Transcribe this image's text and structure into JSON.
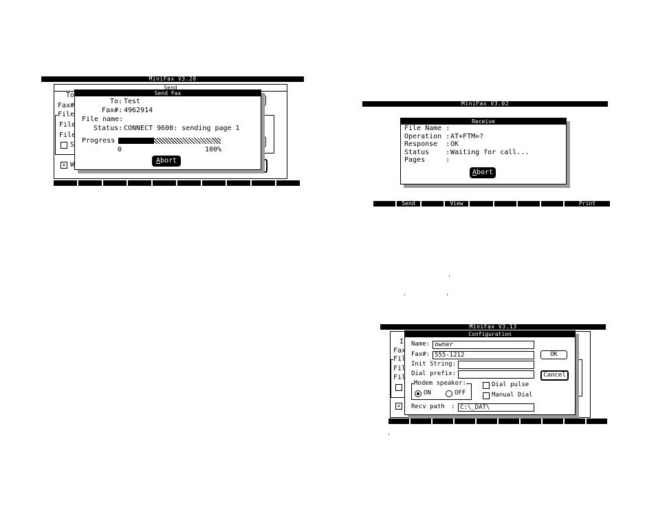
{
  "send_screen": {
    "app_title": "MiniFax  V3.20",
    "bg_panel_title": "Send",
    "bg_labels": [
      "To",
      "Fax#",
      "File",
      "File",
      "File"
    ],
    "bg_checkbox_label": "S",
    "bg_checkbox2_label": "W",
    "dialog": {
      "title": "Send Fax",
      "to_label": "To:",
      "to_value": "Test",
      "fax_label": "Fax#:",
      "fax_value": "4962914",
      "file_label": "File name:",
      "file_value": "",
      "status_label": "Status:",
      "status_value": "CONNECT 9600: sending page 1",
      "progress_label": "Progress",
      "progress_min": "0",
      "progress_max": "100%",
      "progress_fraction": 0.35,
      "abort_label": "Abort"
    },
    "function_keys": [
      "",
      "",
      "",
      "",
      "",
      "",
      "",
      "",
      "",
      ""
    ]
  },
  "receive_screen": {
    "app_title": "MiniFax  V3.02",
    "dialog": {
      "title": "Receive",
      "rows": [
        {
          "label": "File Name",
          "value": ""
        },
        {
          "label": "Operation",
          "value": "AT+FTM=?"
        },
        {
          "label": "Response ",
          "value": "OK"
        },
        {
          "label": "Status   ",
          "value": "Waiting for call..."
        },
        {
          "label": "Pages    ",
          "value": ""
        }
      ],
      "abort_label": "Abort"
    },
    "function_keys": [
      "",
      "Send",
      "",
      "View",
      "",
      "",
      "",
      "",
      "Print"
    ]
  },
  "config_screen": {
    "app_title": "MiniFax  V3.13",
    "bg_labels": [
      "I",
      "Fax",
      "Fil",
      "Fil",
      "Fil"
    ],
    "dialog": {
      "title": "Configuration",
      "name_label": "Name:",
      "name_value": "owner",
      "fax_label": "Fax#:",
      "fax_value": "555-1212",
      "init_label": "Init String:",
      "init_value": "",
      "dial_label": "Dial prefix:",
      "dial_value": "",
      "ok_label": "OK",
      "cancel_label": "Cancel",
      "speaker_group_label": "Modem speaker:",
      "speaker_on_label": "ON",
      "speaker_off_label": "OFF",
      "dial_pulse_label": "Dial pulse",
      "manual_dial_label": "Manual Dial",
      "recv_path_label": "Recv path",
      "recv_path_value": "C:\\_DAT\\"
    },
    "function_keys": [
      "",
      "",
      "",
      "",
      "",
      "",
      "",
      "",
      "",
      ""
    ]
  }
}
